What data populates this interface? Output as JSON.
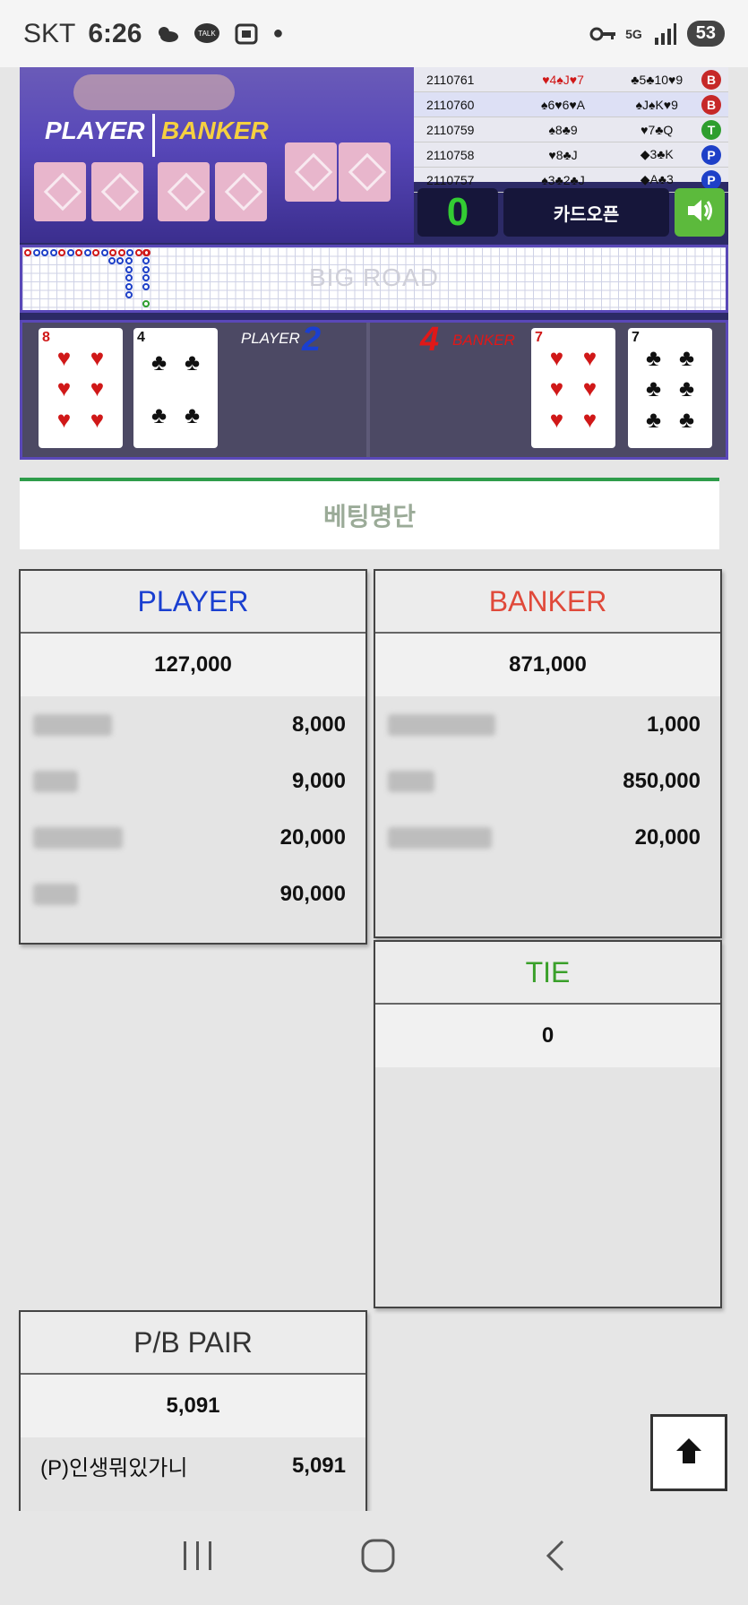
{
  "status_bar": {
    "carrier": "SKT",
    "time": "6:26",
    "battery": "53",
    "network": "5G"
  },
  "game": {
    "scene_player_label": "PLAYER",
    "scene_banker_label": "BANKER",
    "history": [
      {
        "id": "2110761",
        "player": "♥4♠J♥7",
        "banker": "♣5♣10♥9",
        "result": "B"
      },
      {
        "id": "2110760",
        "player": "♠6♥6♥A",
        "banker": "♠J♠K♥9",
        "result": "B"
      },
      {
        "id": "2110759",
        "player": "♠8♣9",
        "banker": "♥7♣Q",
        "result": "T"
      },
      {
        "id": "2110758",
        "player": "♥8♣J",
        "banker": "◆3♣K",
        "result": "P"
      },
      {
        "id": "2110757",
        "player": "♠3♣2♣J",
        "banker": "◆A♣3",
        "result": "P"
      }
    ],
    "count": "0",
    "card_open_label": "카드오픈",
    "big_road_label": "BIG ROAD",
    "player_label": "PLAYER",
    "player_score": "2",
    "banker_label": "BANKER",
    "banker_score": "4",
    "player_cards": [
      {
        "rank": "8",
        "suit": "♥",
        "color": "#d01818"
      },
      {
        "rank": "4",
        "suit": "♣",
        "color": "#111111"
      }
    ],
    "banker_cards": [
      {
        "rank": "7",
        "suit": "♥",
        "color": "#d01818"
      },
      {
        "rank": "7",
        "suit": "♣",
        "color": "#111111"
      }
    ]
  },
  "betting_list_title": "베팅명단",
  "player_box": {
    "title": "PLAYER",
    "color": "#1a3fd0",
    "total": "127,000",
    "entries": [
      "8,000",
      "9,000",
      "20,000",
      "90,000"
    ]
  },
  "banker_box": {
    "title": "BANKER",
    "color": "#e0493a",
    "total": "871,000",
    "entries": [
      "1,000",
      "850,000",
      "20,000"
    ]
  },
  "tie_box": {
    "title": "TIE",
    "color": "#3aa02a",
    "total": "0"
  },
  "pair_box": {
    "title": "P/B PAIR",
    "color": "#333333",
    "total": "5,091",
    "entry_name": "(P)인생뭐있가니",
    "entry_amount": "5,091"
  }
}
